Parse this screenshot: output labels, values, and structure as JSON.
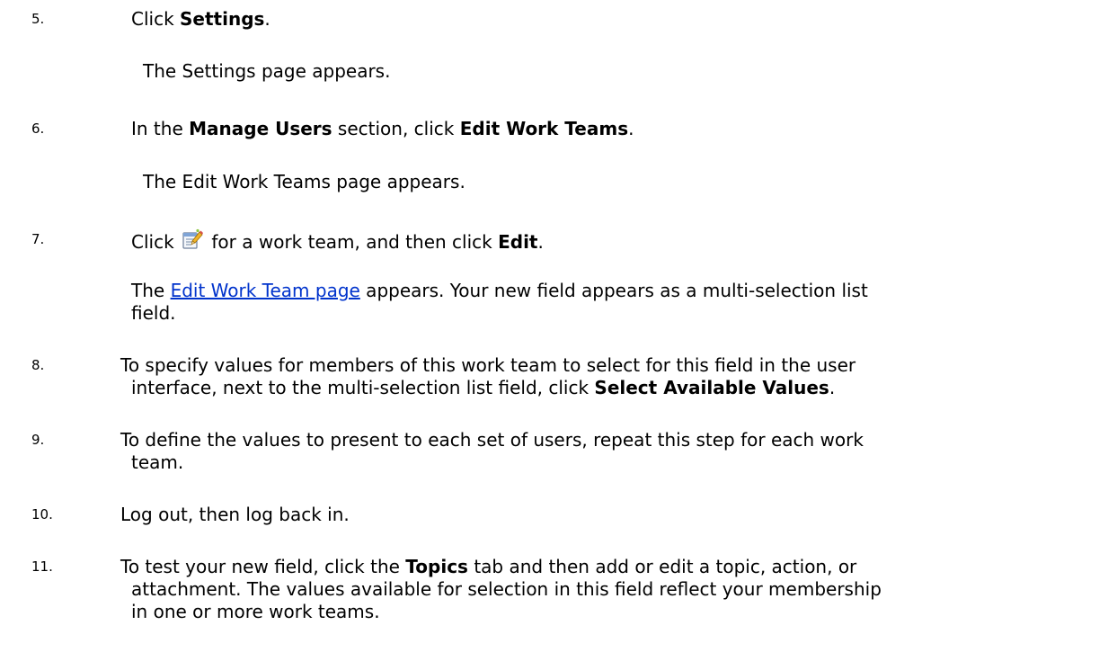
{
  "steps": [
    {
      "number": "5.",
      "text_before": "Click ",
      "bold": "Settings",
      "text_after": ".",
      "result": "The Settings page appears."
    },
    {
      "number": "6.",
      "text_before": "In the ",
      "bold1": "Manage Users",
      "text_middle": " section, click ",
      "bold2": "Edit Work Teams",
      "text_after": ".",
      "result": "The Edit Work Teams page appears."
    },
    {
      "number": "7.",
      "text_before": "Click ",
      "icon": "edit-properties-icon",
      "text_middle": " for a work team, and then click ",
      "bold": "Edit",
      "text_after": ".",
      "result_before": "The ",
      "result_link": "Edit Work Team page",
      "result_after_line1": " appears. Your new field appears as a multi-selection list",
      "result_line2": "field."
    },
    {
      "number": "8.",
      "line1": "To specify values for members of this work team to select for this field in the user",
      "line2_before": "interface, next to the multi-selection list field, click ",
      "bold": "Select Available Values",
      "text_after": "."
    },
    {
      "number": "9.",
      "line1": "To define the values to present to each set of users, repeat this step for each work",
      "line2": "team."
    },
    {
      "number": "10.",
      "text": "Log out, then log back in."
    },
    {
      "number": "11.",
      "line1_before": "To test your new field, click the ",
      "bold": "Topics",
      "line1_after": " tab and then add or edit a topic, action, or",
      "line2": "attachment. The values available for selection in this field reflect your membership",
      "line3": "in one or more work teams."
    }
  ],
  "colors": {
    "text": "#000000",
    "link": "#0033cc"
  }
}
